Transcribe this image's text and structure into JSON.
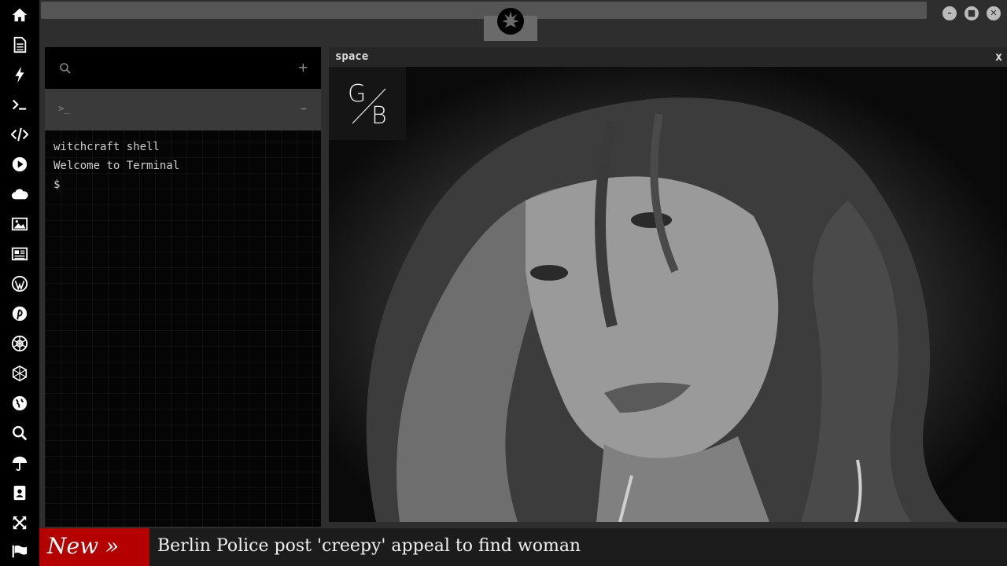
{
  "dock": {
    "icons": [
      "home-icon",
      "document-icon",
      "bolt-icon",
      "terminal-icon",
      "code-icon",
      "play-icon",
      "cloud-icon",
      "image-icon",
      "newspaper-icon",
      "wordpress-icon",
      "pinterest-icon",
      "rebel-icon",
      "grid-sphere-icon",
      "globe-icon",
      "search-icon",
      "umbrella-icon",
      "contacts-icon",
      "expand-icon",
      "flag-icon"
    ]
  },
  "terminal": {
    "search_plus": "+",
    "tab_prompt": ">_",
    "tab_minus": "–",
    "lines": [
      "witchcraft shell",
      "Welcome to Terminal",
      "$"
    ]
  },
  "space": {
    "title": "space",
    "close": "x",
    "logo_top": "G",
    "logo_bottom": "B"
  },
  "ticker": {
    "badge": "New »",
    "headline": "Berlin Police post 'creepy' appeal to find woman"
  },
  "colors": {
    "accent_red": "#b50000",
    "dock_bg": "#000000",
    "panel_bg": "#2e2e2e"
  }
}
